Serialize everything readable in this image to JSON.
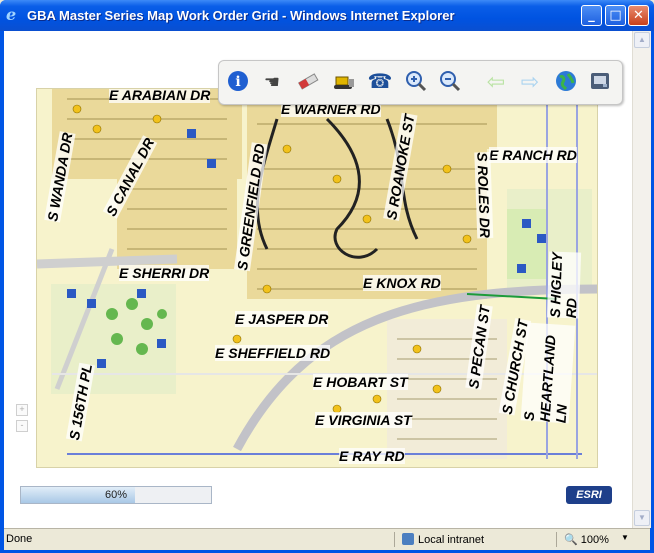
{
  "window": {
    "title": "GBA Master Series Map Work Order Grid - Windows Internet Explorer",
    "buttons": {
      "minimize": "_",
      "maximize": "□",
      "close": "✕"
    }
  },
  "toolbar": {
    "tools": [
      {
        "name": "identify",
        "icon": "info-icon",
        "glyph": "i",
        "color": "#1f5fd1"
      },
      {
        "name": "pan",
        "icon": "hand-icon",
        "glyph": "☚",
        "color": "#444444"
      },
      {
        "name": "clear",
        "icon": "eraser-icon",
        "glyph": "▬",
        "color": "#cc3333"
      },
      {
        "name": "work-order",
        "icon": "bulldozer-icon",
        "glyph": "▞",
        "color": "#d9b400"
      },
      {
        "name": "phone",
        "icon": "phone-icon",
        "glyph": "☎",
        "color": "#1d4f9a"
      },
      {
        "name": "zoom-in",
        "icon": "zoom-in-icon",
        "glyph": "⊕",
        "color": "#2f5fae"
      },
      {
        "name": "zoom-out",
        "icon": "zoom-out-icon",
        "glyph": "⊖",
        "color": "#2f5fae"
      },
      {
        "name": "back",
        "icon": "arrow-left-icon",
        "glyph": "⇦",
        "color": "#b9e3a3"
      },
      {
        "name": "forward",
        "icon": "arrow-right-icon",
        "glyph": "⇨",
        "color": "#a9d3f0"
      },
      {
        "name": "full-extent",
        "icon": "globe-icon",
        "glyph": "◍",
        "color": "#2e9a3a"
      },
      {
        "name": "print",
        "icon": "printer-icon",
        "glyph": "▣",
        "color": "#3b4f6a"
      }
    ]
  },
  "map": {
    "streets": [
      {
        "label": "E ARABIAN DR"
      },
      {
        "label": "E WARNER RD"
      },
      {
        "label": "E RANCH RD"
      },
      {
        "label": "S WANDA DR"
      },
      {
        "label": "S CANAL DR"
      },
      {
        "label": "S GREENFIELD RD"
      },
      {
        "label": "S ROANOKE ST"
      },
      {
        "label": "S ROLES DR"
      },
      {
        "label": "S HIGLEY RD"
      },
      {
        "label": "E SHERRI DR"
      },
      {
        "label": "E KNOX RD"
      },
      {
        "label": "E JASPER DR"
      },
      {
        "label": "E SHEFFIELD RD"
      },
      {
        "label": "S PECAN ST"
      },
      {
        "label": "S CHURCH ST"
      },
      {
        "label": "S HEARTLAND LN"
      },
      {
        "label": "E HOBART ST"
      },
      {
        "label": "E VIRGINIA ST"
      },
      {
        "label": "E RAY RD"
      },
      {
        "label": "S 156TH PL"
      }
    ],
    "zoom_controls": {
      "plus": "+",
      "minus": "-"
    }
  },
  "progress": {
    "value": 60,
    "label": "60%"
  },
  "brand": {
    "logo": "ESRI"
  },
  "statusbar": {
    "status": "Done",
    "zone": "Local intranet",
    "zoom": "100%",
    "zoom_dropdown": "▼"
  }
}
